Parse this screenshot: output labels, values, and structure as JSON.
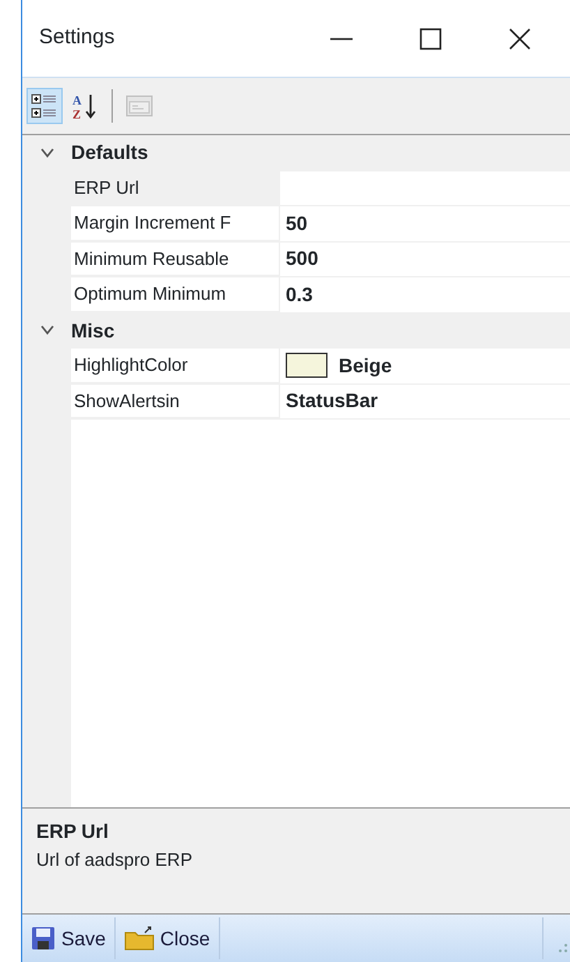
{
  "window": {
    "title": "Settings"
  },
  "toolbar": [
    {
      "kind": "categorized",
      "selected": true,
      "disabled": false
    },
    {
      "kind": "alphabetical",
      "glyphs": [
        "A",
        "Z"
      ],
      "selected": false,
      "disabled": false
    },
    {
      "kind": "pages",
      "selected": false,
      "disabled": true
    }
  ],
  "categories": [
    {
      "name": "Defaults",
      "expanded": true,
      "properties": [
        {
          "label": "ERP Url",
          "selected": true
        },
        {
          "label": "Margin Increment F",
          "value": "50",
          "selected": false
        },
        {
          "label": "Minimum Reusable",
          "value": "500",
          "selected": false
        },
        {
          "label": "Optimum Minimum",
          "value": "0.3",
          "selected": false
        }
      ]
    },
    {
      "name": "Misc",
      "expanded": true,
      "properties": [
        {
          "label": "HighlightColor",
          "value": "Beige",
          "color": "#f5f5dc",
          "selected": false
        },
        {
          "label": "ShowAlertsin",
          "value": "StatusBar",
          "selected": false
        }
      ]
    }
  ],
  "description": {
    "title": "ERP Url",
    "text": "Url of aadspro ERP"
  },
  "status_bar": [
    {
      "kind": "save",
      "label": "Save"
    },
    {
      "kind": "close",
      "label": "Close"
    }
  ]
}
